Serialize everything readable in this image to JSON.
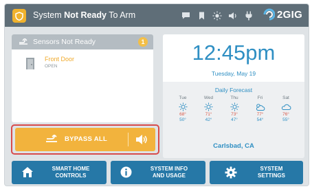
{
  "topbar": {
    "status_prefix": "System ",
    "status_bold": "Not Ready",
    "status_suffix": " To Arm",
    "brand": "2GIG",
    "icons": [
      "chat-icon",
      "bookmark-icon",
      "brightness-icon",
      "volume-icon",
      "plug-icon",
      "brand-logo-icon"
    ]
  },
  "sensors": {
    "header": "Sensors Not Ready",
    "count": "1",
    "items": [
      {
        "name": "Front Door",
        "state": "OPEN"
      }
    ]
  },
  "bypass": {
    "label": "BYPASS ALL"
  },
  "clock": {
    "time": "12:45pm",
    "date": "Tuesday, May 19"
  },
  "forecast": {
    "title": "Daily Forecast",
    "days": [
      {
        "name": "Tue",
        "icon": "sun-icon",
        "hi": "68°",
        "lo": "50°"
      },
      {
        "name": "Wed",
        "icon": "sun-icon",
        "hi": "71°",
        "lo": "42°"
      },
      {
        "name": "Thu",
        "icon": "sun-icon",
        "hi": "73°",
        "lo": "47°"
      },
      {
        "name": "Fri",
        "icon": "partly-cloudy-icon",
        "hi": "77°",
        "lo": "54°"
      },
      {
        "name": "Sat",
        "icon": "cloudy-icon",
        "hi": "76°",
        "lo": "55°"
      }
    ],
    "location": "Carlsbad, CA"
  },
  "bottom": {
    "smart_home": [
      "SMART HOME",
      "CONTROLS"
    ],
    "system_info": [
      "SYSTEM INFO",
      "AND USAGE"
    ],
    "system_settings": [
      "SYSTEM",
      "SETTINGS"
    ]
  },
  "colors": {
    "topbar": "#5f6e78",
    "accent_orange": "#f2b33d",
    "accent_blue": "#2f8fc3",
    "button_blue": "#2678a7",
    "highlight_red": "#d84b4b"
  }
}
